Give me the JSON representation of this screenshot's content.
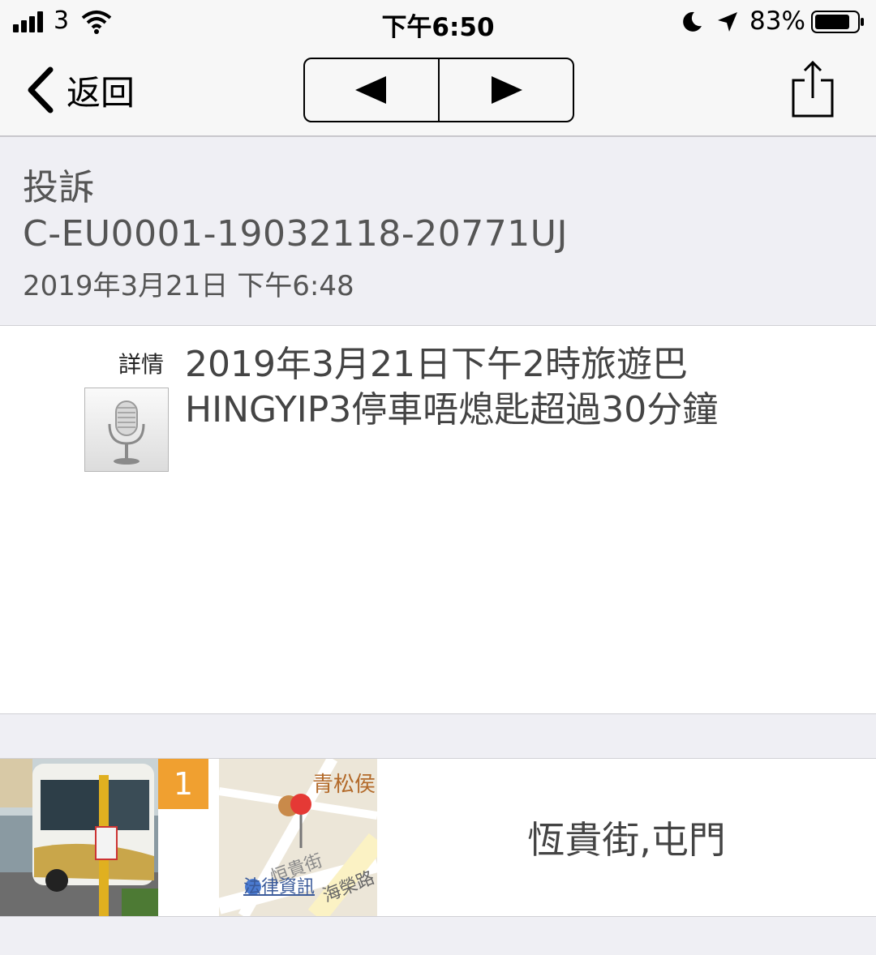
{
  "status_bar": {
    "carrier": "3",
    "time": "下午6:50",
    "battery": "83%"
  },
  "nav": {
    "back_label": "返回",
    "prev_icon": "left-triangle-icon",
    "next_icon": "right-triangle-icon",
    "share_icon": "share-icon"
  },
  "record": {
    "category": "投訴",
    "reference": "C-EU0001-19032118-20771UJ",
    "datetime": "2019年3月21日 下午6:48"
  },
  "details": {
    "label": "詳情",
    "text": "2019年3月21日下午2時旅遊巴HINGYIP3停車唔熄匙超過30分鐘",
    "audio_icon": "microphone-icon"
  },
  "attachments": {
    "photo_count": "1",
    "map_poi": "青松侯",
    "map_street_1": "恒貴街",
    "map_street_2": "法律資訊",
    "map_street_3": "海榮路",
    "location": "恆貴街,屯門"
  },
  "colors": {
    "badge": "#f0a030",
    "map_pin": "#e53935"
  }
}
